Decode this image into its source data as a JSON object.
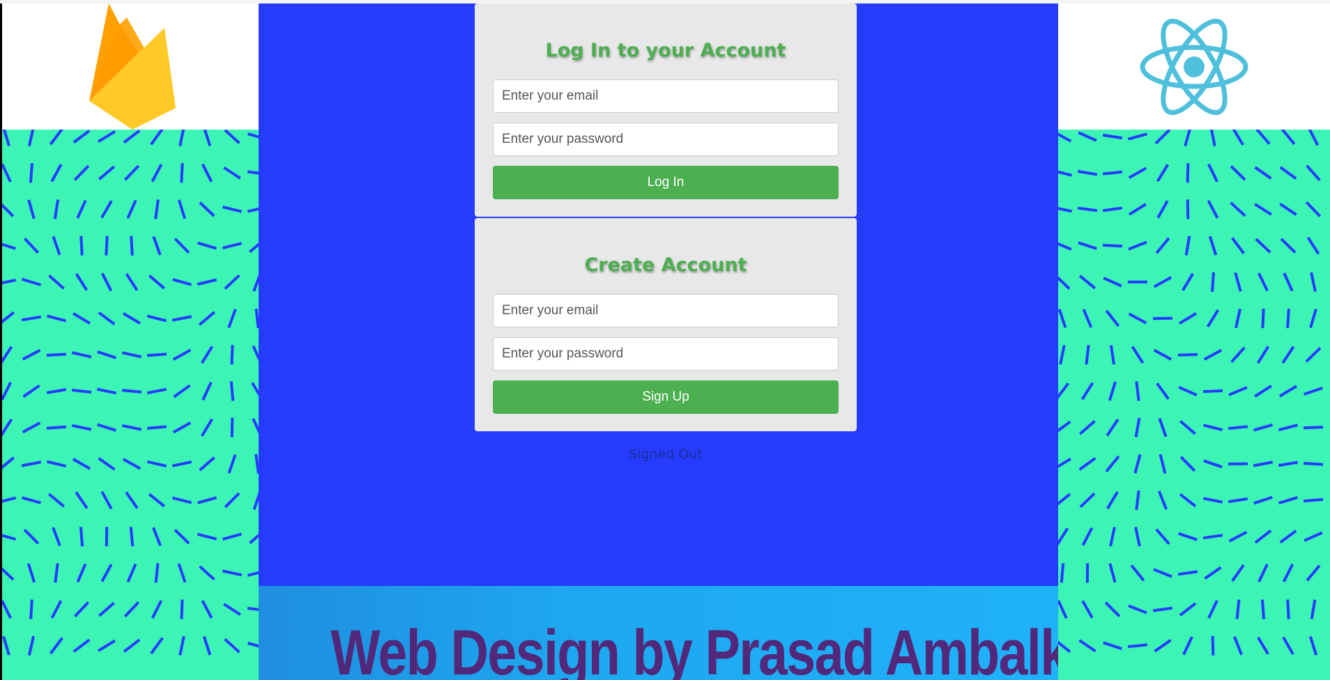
{
  "sidebar_left": {
    "logo_icon": "firebase-icon"
  },
  "sidebar_right": {
    "logo_icon": "react-icon"
  },
  "colors": {
    "center_background": "#253cfe",
    "pattern_background": "#3cf5b4",
    "pattern_stroke": "#253cfe",
    "accent_green": "#4caf50",
    "footer_text": "#52287a"
  },
  "login": {
    "title": "Log In to your Account",
    "email_placeholder": "Enter your email",
    "password_placeholder": "Enter your password",
    "button_label": "Log In"
  },
  "signup": {
    "title": "Create Account",
    "email_placeholder": "Enter your email",
    "password_placeholder": "Enter your password",
    "button_label": "Sign Up"
  },
  "status_text": "Signed Out",
  "footer": {
    "title": "Web Design by Prasad Ambalkar"
  }
}
